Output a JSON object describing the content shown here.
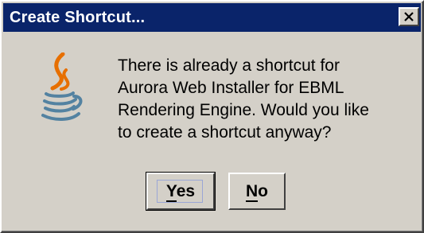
{
  "dialog": {
    "title": "Create Shortcut...",
    "close_icon": "close-icon",
    "icon": "java-coffee-cup-icon",
    "message_lines": [
      "There is already a shortcut for",
      "Aurora Web Installer for EBML",
      "Rendering Engine. Would you like",
      "to create a shortcut anyway?"
    ],
    "buttons": {
      "yes_label": "Yes",
      "yes_mnemonic": "Y",
      "yes_rest": "es",
      "no_label": "No",
      "no_mnemonic": "N",
      "no_rest": "o"
    }
  },
  "colors": {
    "titlebar": "#0a246a",
    "dialog_bg": "#d4d0c8",
    "java_blue": "#5382a1",
    "java_red": "#e76f00"
  }
}
